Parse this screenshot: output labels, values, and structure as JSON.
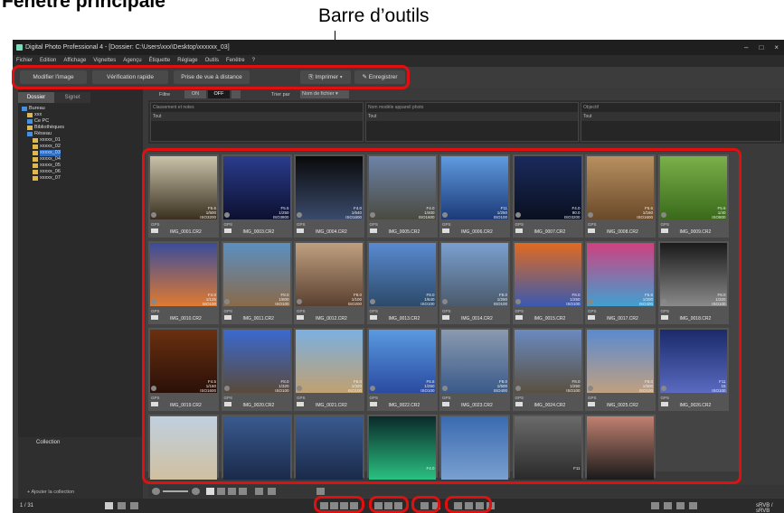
{
  "heading": "Fenêtre principale",
  "callout": "Barre d’outils",
  "window": {
    "title": "Digital Photo Professional 4 - [Dossier: C:\\Users\\xxx\\Desktop\\xxxxxx_03]",
    "controls": [
      "–",
      "□",
      "×"
    ]
  },
  "menu": [
    "Fichier",
    "Edition",
    "Affichage",
    "Vignettes",
    "Agençu",
    "Étiquette",
    "Réglage",
    "Outils",
    "Fenêtre",
    "?"
  ],
  "toolbar": {
    "edit": "Modifier l'image",
    "quick": "Vérification rapide",
    "distance": "Prise de vue à distance",
    "print": "Imprimer",
    "save": "Enregistrer"
  },
  "left": {
    "tab_folder": "Dossier",
    "tab_bookmark": "Signet",
    "tree": [
      {
        "label": "Bureau",
        "level": 0,
        "icon": "blue"
      },
      {
        "label": "xxx",
        "level": 1,
        "icon": "yellow"
      },
      {
        "label": "Ce PC",
        "level": 1,
        "icon": "blue"
      },
      {
        "label": "Bibliothèques",
        "level": 1,
        "icon": "yellow"
      },
      {
        "label": "Réseau",
        "level": 1,
        "icon": "blue"
      },
      {
        "label": "xxxxx_01",
        "level": 2,
        "icon": "yellow"
      },
      {
        "label": "xxxxx_02",
        "level": 2,
        "icon": "yellow"
      },
      {
        "label": "xxxxx_03",
        "level": 2,
        "icon": "yellow",
        "selected": true
      },
      {
        "label": "xxxxx_04",
        "level": 2,
        "icon": "yellow"
      },
      {
        "label": "xxxxx_05",
        "level": 2,
        "icon": "yellow"
      },
      {
        "label": "xxxxx_06",
        "level": 2,
        "icon": "yellow"
      },
      {
        "label": "xxxxx_07",
        "level": 2,
        "icon": "yellow"
      }
    ],
    "collection_title": "Collection",
    "collection_add": "Ajouter la collection"
  },
  "filter": {
    "label": "Filtre",
    "on": "ON",
    "off": "OFF",
    "sort_label": "Trier par",
    "sort_value": "Nom de fichier"
  },
  "info_headers": [
    "Classement et notes",
    "Nom modèle appareil photo",
    "Objectif"
  ],
  "info_sub": [
    "Tout",
    "Tout",
    "Tout"
  ],
  "thumbs": [
    {
      "name": "IMG_0001.CR2",
      "meta": "F5.6|1/500|ISO3200",
      "c1": "#c9c2a8",
      "c2": "#3b3020"
    },
    {
      "name": "IMG_0003.CR2",
      "meta": "F5.5|1/250|ISO3800",
      "c1": "#2a3c8c",
      "c2": "#0c1030"
    },
    {
      "name": "IMG_0004.CR2",
      "meta": "F4.0|1/640|ISO1600",
      "c1": "#0a0a0a",
      "c2": "#3a4a6c"
    },
    {
      "name": "IMG_0005.CR2",
      "meta": "F4.0|1/400|ISO1600",
      "c1": "#6d83a8",
      "c2": "#4a4a40"
    },
    {
      "name": "IMG_0006.CR2",
      "meta": "F11|1/250|ISO100",
      "c1": "#5f9be0",
      "c2": "#1c3a78"
    },
    {
      "name": "IMG_0007.CR2",
      "meta": "F4.0|90.0|ISO3200",
      "c1": "#1a2a5c",
      "c2": "#0a1020"
    },
    {
      "name": "IMG_0008.CR2",
      "meta": "F5.6|1/160|ISO1600",
      "c1": "#b89060",
      "c2": "#6a4a2a"
    },
    {
      "name": "IMG_0009.CR2",
      "meta": "F5.6|1/40|ISO800",
      "c1": "#7ab04a",
      "c2": "#3a6a1a"
    },
    {
      "name": "IMG_0010.CR2",
      "meta": "F4.0|1/125|ISO100",
      "c1": "#3a4c9c",
      "c2": "#e07a30"
    },
    {
      "name": "IMG_0011.CR2",
      "meta": "F8.0|1/800|ISO100",
      "c1": "#5b8fc0",
      "c2": "#8a6a4a"
    },
    {
      "name": "IMG_0012.CR2",
      "meta": "F8.0|1/100|ISO200",
      "c1": "#c0a080",
      "c2": "#5a4030"
    },
    {
      "name": "IMG_0013.CR2",
      "meta": "F8.0|1/640|ISO100",
      "c1": "#5a8ad0",
      "c2": "#2c4a6a"
    },
    {
      "name": "IMG_0014.CR2",
      "meta": "F8.0|1/250|ISO100",
      "c1": "#7aa0d0",
      "c2": "#4a5a6a"
    },
    {
      "name": "IMG_0015.CR2",
      "meta": "F8.0|1/250|ISO100",
      "c1": "#e06a20",
      "c2": "#3a5ab0"
    },
    {
      "name": "IMG_0017.CR2",
      "meta": "F5.6|1/200|ISO400",
      "c1": "#d04080",
      "c2": "#40a0d0"
    },
    {
      "name": "IMG_0018.CR2",
      "meta": "F8.0|1/320|ISO100",
      "c1": "#1a1a1a",
      "c2": "#8a8a8a"
    },
    {
      "name": "IMG_0019.CR2",
      "meta": "F4.5|1/160|ISO1600",
      "c1": "#6a3010",
      "c2": "#2a1008"
    },
    {
      "name": "IMG_0020.CR2",
      "meta": "F8.0|1/320|ISO100",
      "c1": "#3a6ad0",
      "c2": "#5a4a3a"
    },
    {
      "name": "IMG_0021.CR2",
      "meta": "F8.0|1/320|ISO100",
      "c1": "#7ab0e0",
      "c2": "#c0a070"
    },
    {
      "name": "IMG_0022.CR2",
      "meta": "F5.6|1/250|ISO100",
      "c1": "#5a9ae0",
      "c2": "#2a4aa0"
    },
    {
      "name": "IMG_0023.CR2",
      "meta": "F8.0|1/500|ISO400",
      "c1": "#8a9ab0",
      "c2": "#3a5a8a"
    },
    {
      "name": "IMG_0024.CR2",
      "meta": "F8.0|1/250|ISO100",
      "c1": "#6a8ac0",
      "c2": "#5a5040"
    },
    {
      "name": "IMG_0025.CR2",
      "meta": "F8.0|1/500|ISO100",
      "c1": "#5a8ad0",
      "c2": "#c0a080"
    },
    {
      "name": "IMG_0026.CR2",
      "meta": "F11|15|ISO100",
      "c1": "#1a2a6a",
      "c2": "#5a6ac0"
    },
    {
      "name": "",
      "meta": "",
      "c1": "#c0d0e0",
      "c2": "#d0c0a0"
    },
    {
      "name": "",
      "meta": "",
      "c1": "#3a5a90",
      "c2": "#1a2a4a"
    },
    {
      "name": "",
      "meta": "",
      "c1": "#3a5a90",
      "c2": "#1a2a4a"
    },
    {
      "name": "",
      "meta": "F4.0",
      "c1": "#0a2a2a",
      "c2": "#2ac080"
    },
    {
      "name": "",
      "meta": "",
      "c1": "#3a6ab0",
      "c2": "#7aa0d0"
    },
    {
      "name": "",
      "meta": "F11",
      "c1": "#6a6a6a",
      "c2": "#2a2a2a"
    },
    {
      "name": "",
      "meta": "",
      "c1": "#c08070",
      "c2": "#1a1a1a"
    }
  ],
  "status": {
    "count": "1 / 31",
    "right": "sRVB / sRVB"
  }
}
